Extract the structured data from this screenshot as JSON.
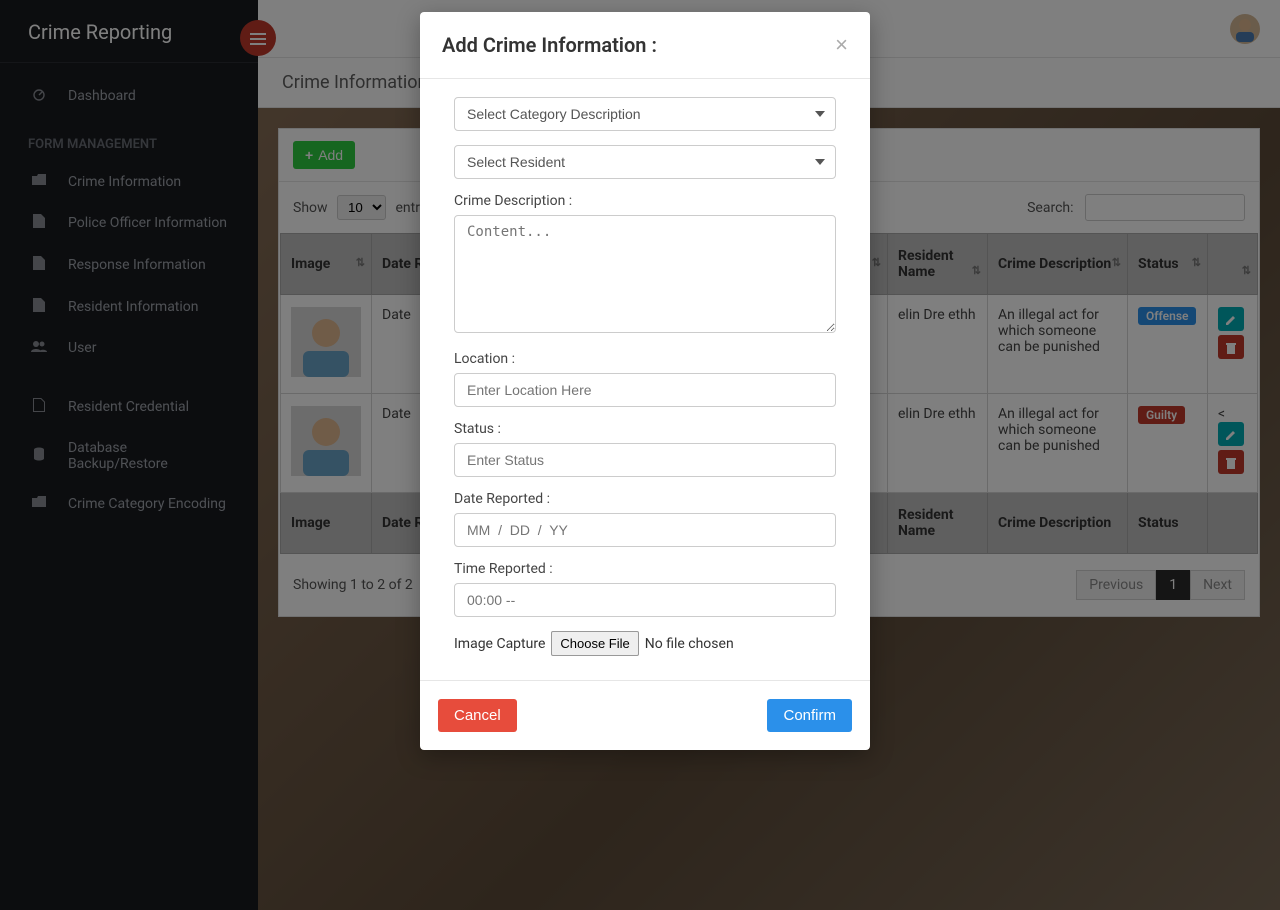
{
  "app_title": "Crime Reporting",
  "sidebar": {
    "dashboard": {
      "label": "Dashboard",
      "icon": "tachometer"
    },
    "section1_label": "FORM MANAGEMENT",
    "items": [
      {
        "label": "Crime Information",
        "icon": "folder"
      },
      {
        "label": "Police Officer Information",
        "icon": "file"
      },
      {
        "label": "Response Information",
        "icon": "file"
      },
      {
        "label": "Resident Information",
        "icon": "file"
      },
      {
        "label": "User",
        "icon": "users"
      }
    ],
    "items2": [
      {
        "label": "Resident Credential",
        "icon": "file-o"
      },
      {
        "label": "Database Backup/Restore",
        "icon": "database"
      },
      {
        "label": "Crime Category Encoding",
        "icon": "folder"
      }
    ]
  },
  "page": {
    "title": "Crime Information",
    "add_button": "Add",
    "show_label": "Show",
    "entries_label": "entries",
    "entries_value": "10",
    "search_label": "Search:",
    "columns": [
      "Image",
      "Date Reported",
      "Resident Name",
      "Crime Description",
      "Status",
      ""
    ],
    "rows": [
      {
        "date_reported": "Date",
        "resident_name": "elin Dre ethh",
        "crime_description": "An illegal act for which someone can be punished",
        "status_label": "Offense",
        "status_color": "blue",
        "action_prefix": ""
      },
      {
        "date_reported": "Date",
        "resident_name": "elin Dre ethh",
        "crime_description": "An illegal act for which someone can be punished",
        "status_label": "Guilty",
        "status_color": "red",
        "action_prefix": "<"
      }
    ],
    "footer_info": "Showing 1 to 2 of 2",
    "pagination": {
      "previous": "Previous",
      "current": "1",
      "next": "Next"
    }
  },
  "modal": {
    "title": "Add Crime Information :",
    "select_category_placeholder": "Select Category Description",
    "select_resident_placeholder": "Select Resident",
    "crime_description_label": "Crime Description :",
    "crime_description_placeholder": "Content...",
    "location_label": "Location :",
    "location_placeholder": "Enter Location Here",
    "status_label": "Status :",
    "status_placeholder": "Enter Status",
    "date_reported_label": "Date Reported :",
    "date_reported_placeholder": "MM  /  DD  /  YY",
    "time_reported_label": "Time Reported :",
    "time_reported_placeholder": "00:00 --",
    "image_capture_label": "Image Capture",
    "choose_file_label": "Choose File",
    "no_file_chosen": "No file chosen",
    "cancel": "Cancel",
    "confirm": "Confirm"
  }
}
